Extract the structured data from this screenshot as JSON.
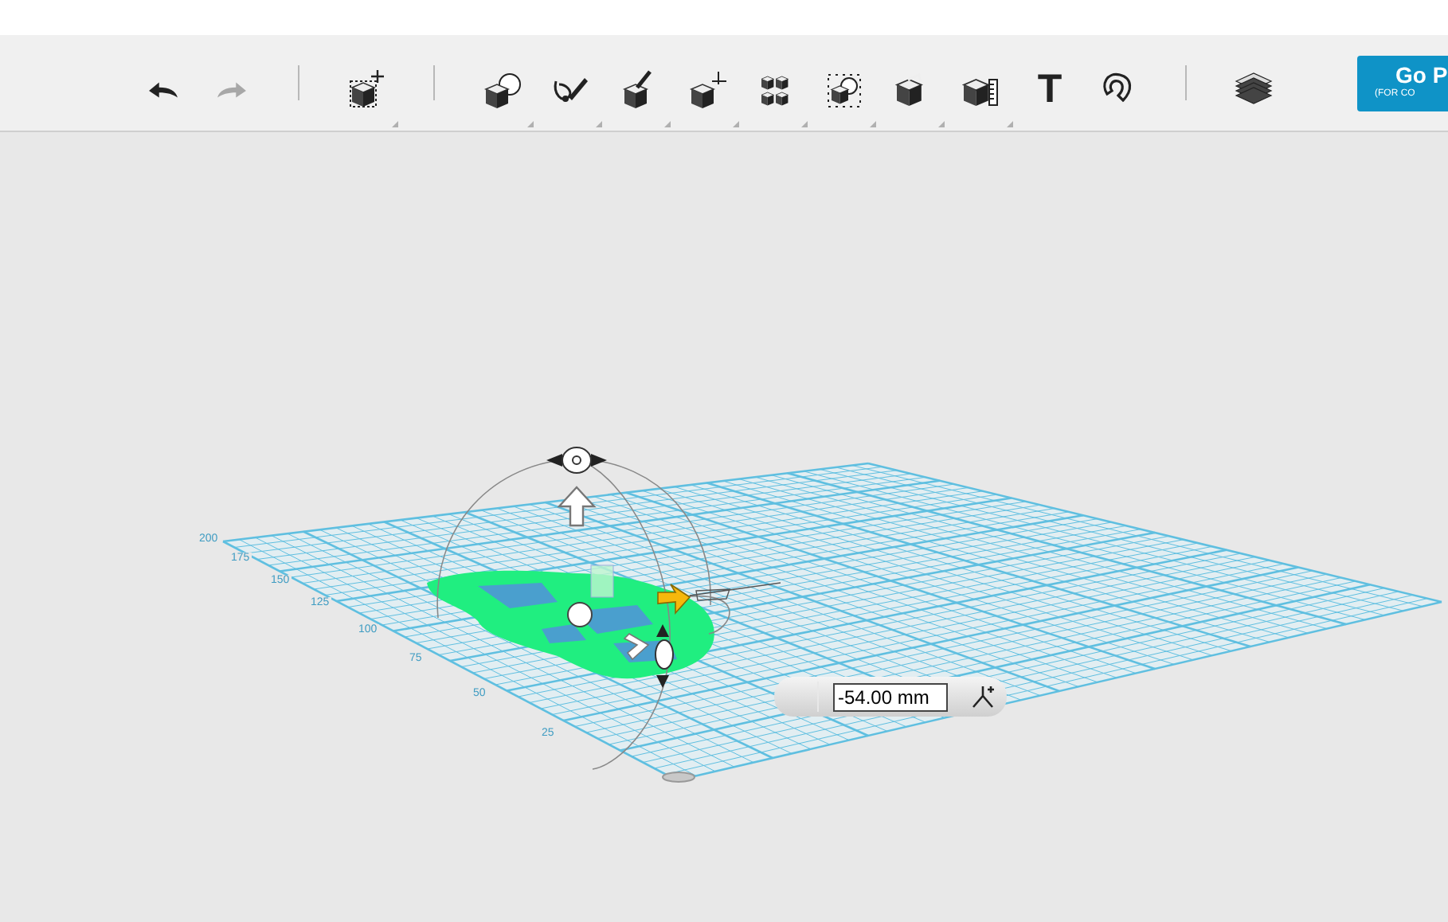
{
  "toolbar": {
    "groups": [
      [
        {
          "kind": "undo",
          "disabled": false,
          "menu": false
        },
        {
          "kind": "redo",
          "disabled": true,
          "menu": false
        }
      ],
      [
        {
          "kind": "transform",
          "disabled": false,
          "menu": true
        }
      ],
      [
        {
          "kind": "primitives",
          "disabled": false,
          "menu": true
        },
        {
          "kind": "sketch",
          "disabled": false,
          "menu": true
        },
        {
          "kind": "construct",
          "disabled": false,
          "menu": true
        },
        {
          "kind": "modify",
          "disabled": false,
          "menu": true
        },
        {
          "kind": "pattern",
          "disabled": false,
          "menu": true
        },
        {
          "kind": "grouping",
          "disabled": false,
          "menu": true
        },
        {
          "kind": "combine",
          "disabled": false,
          "menu": true
        },
        {
          "kind": "measure",
          "disabled": false,
          "menu": true
        },
        {
          "kind": "text",
          "label": "T",
          "disabled": false,
          "menu": false
        },
        {
          "kind": "snap",
          "disabled": false,
          "menu": false
        }
      ],
      [
        {
          "kind": "materials",
          "disabled": false,
          "menu": false
        }
      ]
    ],
    "action_button": {
      "title": "Go P",
      "subtitle": "(FOR CO"
    }
  },
  "viewport": {
    "axis_labels": [
      "200",
      "175",
      "150",
      "125",
      "100",
      "75",
      "50",
      "25"
    ],
    "distance_input": {
      "value": "-54.00 mm"
    }
  }
}
